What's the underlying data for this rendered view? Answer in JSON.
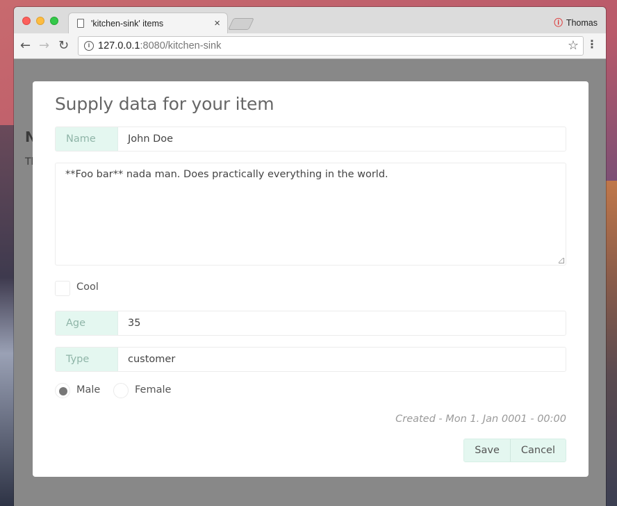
{
  "browser": {
    "tab_title": "'kitchen-sink' items",
    "tab_close": "×",
    "user_name": "Thomas",
    "url_host": "127.0.0.1",
    "url_rest": ":8080/kitchen-sink",
    "icons": {
      "back": "back-arrow-icon",
      "forward": "forward-arrow-icon",
      "reload": "reload-icon",
      "info": "info-icon",
      "bookmark": "star-icon",
      "menu": "menu-dots-icon"
    }
  },
  "background_page": {
    "heading_fragment": "N",
    "text_fragment": "Th"
  },
  "modal": {
    "title": "Supply data for your item",
    "name_label": "Name",
    "name_value": "John Doe",
    "description": "**Foo bar** nada man. Does practically everything in the world.",
    "cool_label": "Cool",
    "cool_checked": false,
    "age_label": "Age",
    "age_value": "35",
    "type_label": "Type",
    "type_value": "customer",
    "gender_options": [
      "Male",
      "Female"
    ],
    "gender_selected": "Male",
    "created_text": "Created - Mon 1. Jan 0001 - 00:00",
    "save_label": "Save",
    "cancel_label": "Cancel"
  },
  "colors": {
    "accent_bg": "#e4f7f0",
    "label_text": "#8fb5a8",
    "overlay": "#888888"
  }
}
